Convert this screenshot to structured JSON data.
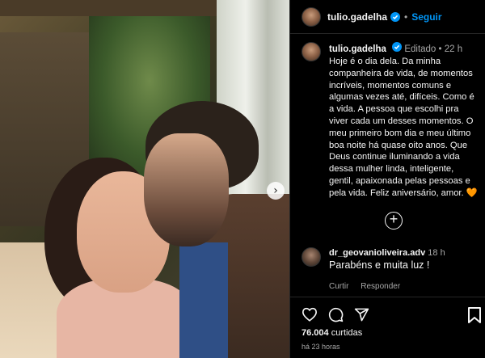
{
  "header": {
    "username": "tulio.gadelha",
    "follow_label": "Seguir",
    "separator": "•"
  },
  "caption": {
    "username": "tulio.gadelha",
    "edited": "Editado",
    "separator": "•",
    "age": "22 h",
    "text": "Hoje é o dia dela. Da minha companheira de vida, de momentos incríveis, momentos comuns e algumas vezes até, difíceis. Como é a vida. A pessoa que escolhi pra viver cada um desses momentos. O meu primeiro bom dia e meu último boa noite há quase oito anos. Que Deus continue iluminando a vida dessa mulher linda, inteligente, gentil, apaixonada pelas pessoas e pela vida. Feliz aniversário, amor.",
    "emoji": "🧡"
  },
  "load_more": "+",
  "comment": {
    "username": "dr_geovanioliveira.adv",
    "age": "18 h",
    "text": "Parabéns e muita luz !",
    "reply_label": "Responder",
    "like_label": "Curtir"
  },
  "footer": {
    "likes_count": "76.004",
    "likes_word": "curtidas",
    "timestamp": "há 23 horas"
  },
  "photo": {
    "next_arrow": "›"
  },
  "colors": {
    "accent": "#0095f6",
    "verified": "#0095f6",
    "background": "#000000"
  },
  "icons": [
    "verified-badge-icon",
    "heart-icon",
    "comment-icon",
    "share-icon",
    "bookmark-icon",
    "add-circle-icon",
    "chevron-right-icon"
  ]
}
